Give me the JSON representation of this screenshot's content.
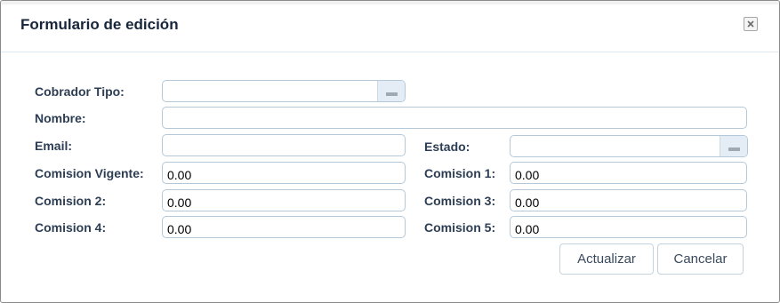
{
  "dialog": {
    "title": "Formulario de edición",
    "close_icon": "close-icon"
  },
  "form": {
    "cobrador_tipo": {
      "label": "Cobrador Tipo:",
      "value": ""
    },
    "nombre": {
      "label": "Nombre:",
      "value": ""
    },
    "email": {
      "label": "Email:",
      "value": ""
    },
    "estado": {
      "label": "Estado:",
      "value": ""
    },
    "comision_vigente": {
      "label": "Comision Vigente:",
      "value": "0.00"
    },
    "comision_1": {
      "label": "Comision 1:",
      "value": "0.00"
    },
    "comision_2": {
      "label": "Comision 2:",
      "value": "0.00"
    },
    "comision_3": {
      "label": "Comision 3:",
      "value": "0.00"
    },
    "comision_4": {
      "label": "Comision 4:",
      "value": "0.00"
    },
    "comision_5": {
      "label": "Comision 5:",
      "value": "0.00"
    }
  },
  "actions": {
    "update_label": "Actualizar",
    "cancel_label": "Cancelar"
  }
}
